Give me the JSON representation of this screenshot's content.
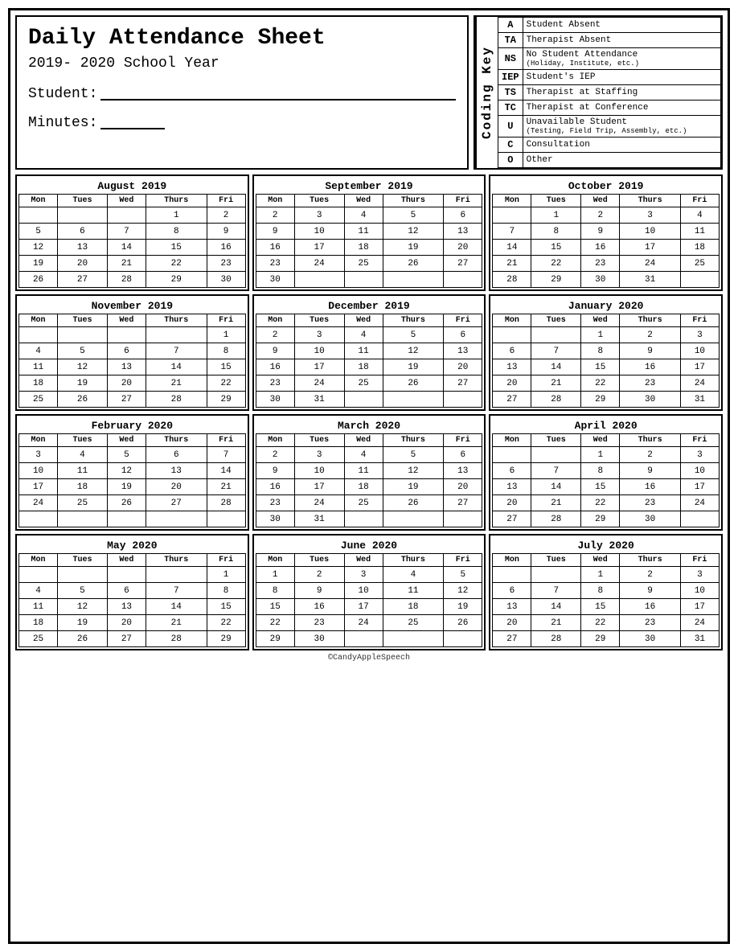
{
  "header": {
    "title": "Daily Attendance Sheet",
    "year": "2019- 2020 School Year",
    "student_label": "Student:",
    "minutes_label": "Minutes:"
  },
  "coding_key": {
    "label": "Coding Key",
    "items": [
      {
        "code": "A",
        "description": "Student Absent",
        "sub": ""
      },
      {
        "code": "TA",
        "description": "Therapist Absent",
        "sub": ""
      },
      {
        "code": "NS",
        "description": "No Student Attendance",
        "sub": "(Holiday, Institute, etc.)"
      },
      {
        "code": "IEP",
        "description": "Student's IEP",
        "sub": ""
      },
      {
        "code": "TS",
        "description": "Therapist at Staffing",
        "sub": ""
      },
      {
        "code": "TC",
        "description": "Therapist at Conference",
        "sub": ""
      },
      {
        "code": "U",
        "description": "Unavailable Student",
        "sub": "(Testing, Field Trip, Assembly, etc.)"
      },
      {
        "code": "C",
        "description": "Consultation",
        "sub": ""
      },
      {
        "code": "O",
        "description": "Other",
        "sub": ""
      }
    ]
  },
  "calendars": [
    {
      "month": "August 2019",
      "days": [
        [
          "",
          "",
          "",
          "1",
          "2"
        ],
        [
          "5",
          "6",
          "7",
          "8",
          "9"
        ],
        [
          "12",
          "13",
          "14",
          "15",
          "16"
        ],
        [
          "19",
          "20",
          "21",
          "22",
          "23"
        ],
        [
          "26",
          "27",
          "28",
          "29",
          "30"
        ]
      ]
    },
    {
      "month": "September 2019",
      "days": [
        [
          "2",
          "3",
          "4",
          "5",
          "6"
        ],
        [
          "9",
          "10",
          "11",
          "12",
          "13"
        ],
        [
          "16",
          "17",
          "18",
          "19",
          "20"
        ],
        [
          "23",
          "24",
          "25",
          "26",
          "27"
        ],
        [
          "30",
          "",
          "",
          "",
          ""
        ]
      ]
    },
    {
      "month": "October 2019",
      "days": [
        [
          "",
          "1",
          "2",
          "3",
          "4"
        ],
        [
          "7",
          "8",
          "9",
          "10",
          "11"
        ],
        [
          "14",
          "15",
          "16",
          "17",
          "18"
        ],
        [
          "21",
          "22",
          "23",
          "24",
          "25"
        ],
        [
          "28",
          "29",
          "30",
          "31",
          ""
        ]
      ]
    },
    {
      "month": "November 2019",
      "days": [
        [
          "",
          "",
          "",
          "",
          "1"
        ],
        [
          "4",
          "5",
          "6",
          "7",
          "8"
        ],
        [
          "11",
          "12",
          "13",
          "14",
          "15"
        ],
        [
          "18",
          "19",
          "20",
          "21",
          "22"
        ],
        [
          "25",
          "26",
          "27",
          "28",
          "29"
        ]
      ]
    },
    {
      "month": "December 2019",
      "days": [
        [
          "2",
          "3",
          "4",
          "5",
          "6"
        ],
        [
          "9",
          "10",
          "11",
          "12",
          "13"
        ],
        [
          "16",
          "17",
          "18",
          "19",
          "20"
        ],
        [
          "23",
          "24",
          "25",
          "26",
          "27"
        ],
        [
          "30",
          "31",
          "",
          "",
          ""
        ]
      ]
    },
    {
      "month": "January 2020",
      "days": [
        [
          "",
          "1",
          "2",
          "3"
        ],
        [
          "6",
          "7",
          "8",
          "9",
          "10"
        ],
        [
          "13",
          "14",
          "15",
          "16",
          "17"
        ],
        [
          "20",
          "21",
          "22",
          "23",
          "24"
        ],
        [
          "27",
          "28",
          "29",
          "30",
          "31"
        ]
      ]
    },
    {
      "month": "February 2020",
      "days": [
        [
          "3",
          "4",
          "5",
          "6",
          "7"
        ],
        [
          "10",
          "11",
          "12",
          "13",
          "14"
        ],
        [
          "17",
          "18",
          "19",
          "20",
          "21"
        ],
        [
          "24",
          "25",
          "26",
          "27",
          "28"
        ],
        [
          "",
          "",
          "",
          "",
          ""
        ]
      ]
    },
    {
      "month": "March 2020",
      "days": [
        [
          "2",
          "3",
          "4",
          "5",
          "6"
        ],
        [
          "9",
          "10",
          "11",
          "12",
          "13"
        ],
        [
          "16",
          "17",
          "18",
          "19",
          "20"
        ],
        [
          "23",
          "24",
          "25",
          "26",
          "27"
        ],
        [
          "30",
          "31",
          "",
          "",
          ""
        ]
      ]
    },
    {
      "month": "April 2020",
      "days": [
        [
          "",
          "1",
          "2",
          "3"
        ],
        [
          "6",
          "7",
          "8",
          "9",
          "10"
        ],
        [
          "13",
          "14",
          "15",
          "16",
          "17"
        ],
        [
          "20",
          "21",
          "22",
          "23",
          "24"
        ],
        [
          "27",
          "28",
          "29",
          "30",
          ""
        ]
      ]
    },
    {
      "month": "May 2020",
      "days": [
        [
          "",
          "",
          "",
          "",
          "1"
        ],
        [
          "4",
          "5",
          "6",
          "7",
          "8"
        ],
        [
          "11",
          "12",
          "13",
          "14",
          "15"
        ],
        [
          "18",
          "19",
          "20",
          "21",
          "22"
        ],
        [
          "25",
          "26",
          "27",
          "28",
          "29"
        ]
      ]
    },
    {
      "month": "June 2020",
      "days": [
        [
          "1",
          "2",
          "3",
          "4",
          "5"
        ],
        [
          "8",
          "9",
          "10",
          "11",
          "12"
        ],
        [
          "15",
          "16",
          "17",
          "18",
          "19"
        ],
        [
          "22",
          "23",
          "24",
          "25",
          "26"
        ],
        [
          "29",
          "30",
          "",
          "",
          ""
        ]
      ]
    },
    {
      "month": "July 2020",
      "days": [
        [
          "",
          "1",
          "2",
          "3"
        ],
        [
          "6",
          "7",
          "8",
          "9",
          "10"
        ],
        [
          "13",
          "14",
          "15",
          "16",
          "17"
        ],
        [
          "20",
          "21",
          "22",
          "23",
          "24"
        ],
        [
          "27",
          "28",
          "29",
          "30",
          "31"
        ]
      ]
    }
  ],
  "day_headers": [
    "Mon",
    "Tues",
    "Wed",
    "Thurs",
    "Fri"
  ],
  "footer": "©CandyAppleSpeech"
}
